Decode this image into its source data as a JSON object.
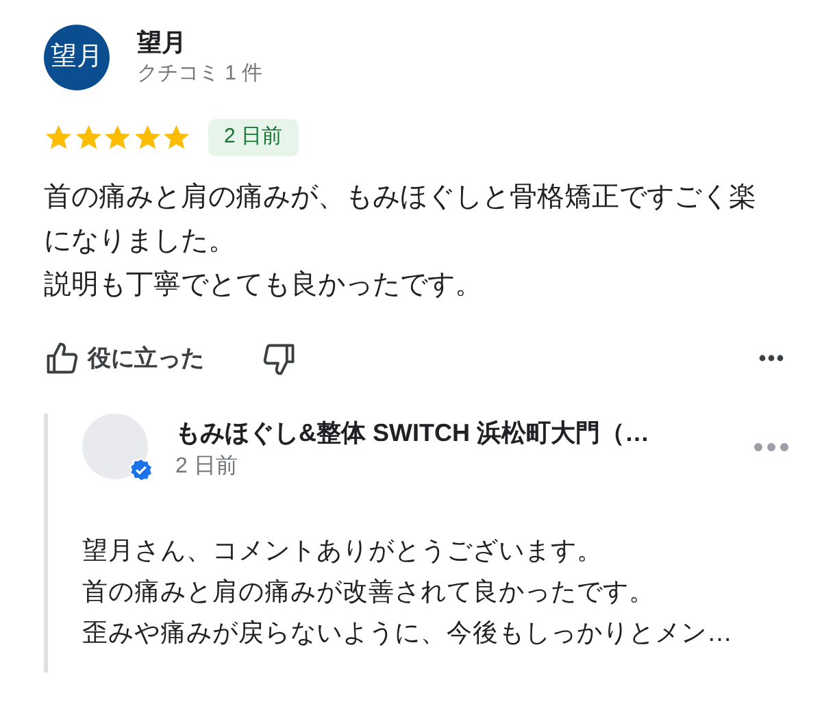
{
  "reviewer": {
    "initials": "望月",
    "name": "望月",
    "subtitle": "クチコミ 1 件"
  },
  "review": {
    "stars": 5,
    "time": "2 日前",
    "paragraphs": [
      "首の痛みと肩の痛みが、もみほぐしと骨格矯正ですごく楽になりました。",
      "説明も丁寧でとても良かったです。"
    ]
  },
  "actions": {
    "helpful_label": "役に立った"
  },
  "reply": {
    "name": "もみほぐし&整体 SWITCH 浜松町大門（…",
    "verified": true,
    "time": "2 日前",
    "lines": [
      "望月さん、コメントありがとうございます。",
      "首の痛みと肩の痛みが改善されて良かったです。",
      "歪みや痛みが戻らないように、今後もしっかりとメン…"
    ]
  }
}
